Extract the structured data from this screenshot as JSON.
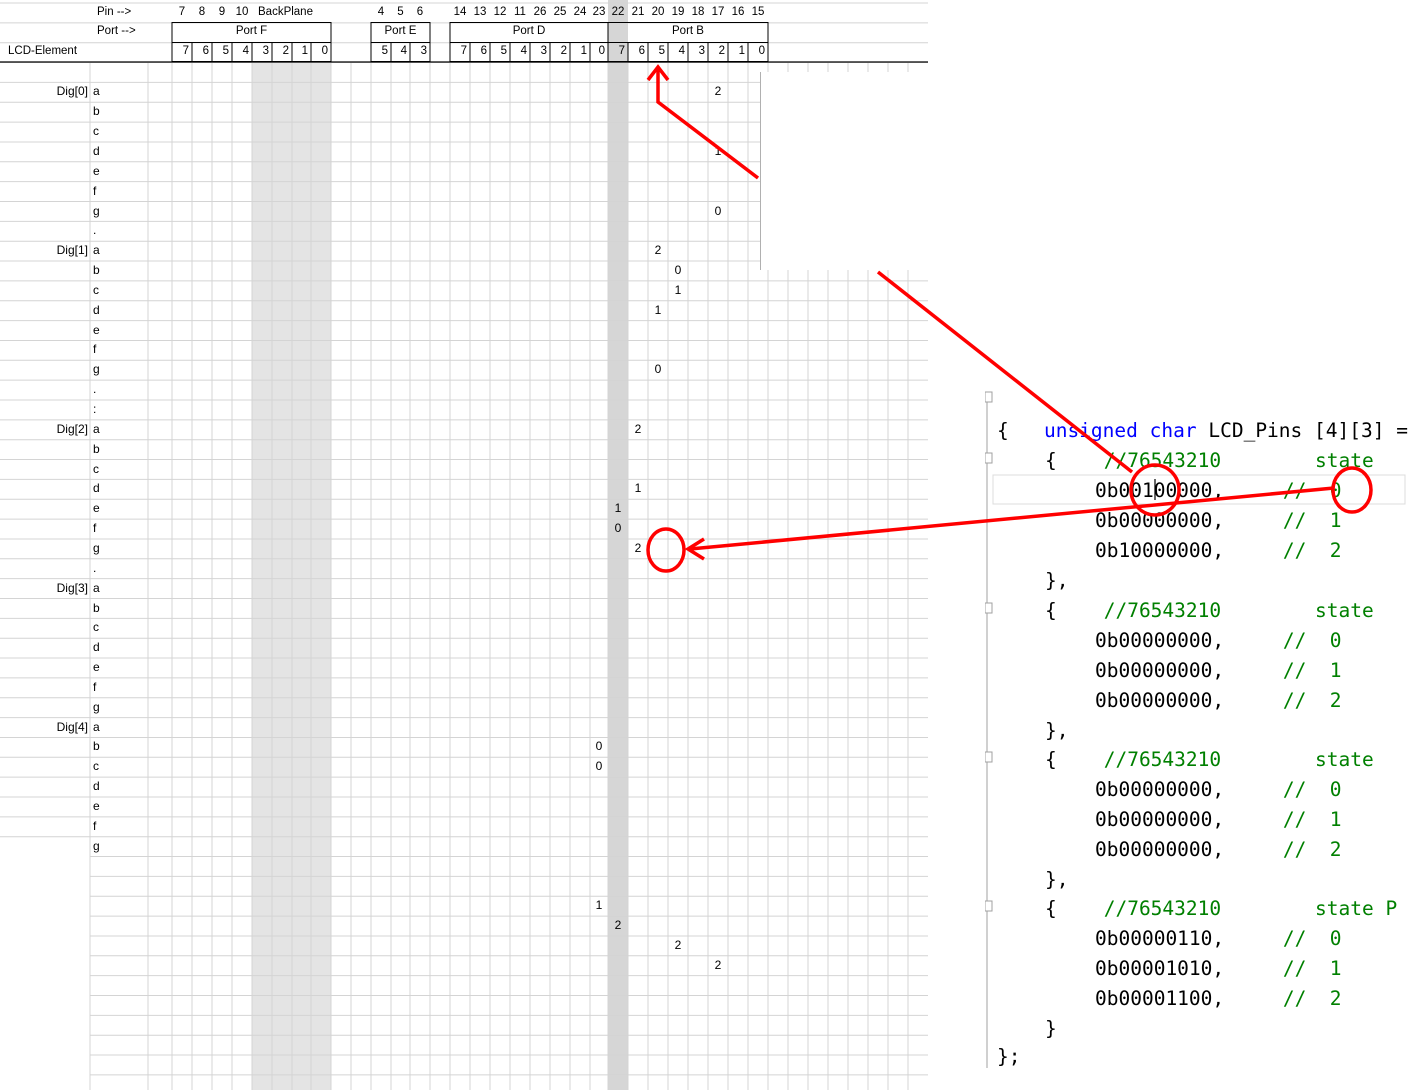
{
  "sheet": {
    "header_pin_label": "Pin -->",
    "header_port_label": "Port -->",
    "header_lcd_label": "LCD-Element",
    "pins": [
      "7",
      "8",
      "9",
      "10",
      "BackPlane",
      "4",
      "5",
      "6",
      "14",
      "13",
      "12",
      "11",
      "26",
      "25",
      "24",
      "23",
      "22",
      "21",
      "20",
      "19",
      "18",
      "17",
      "16",
      "15"
    ],
    "ports": [
      "Port F",
      "Port E",
      "Port D",
      "Port B"
    ],
    "bits": [
      "7",
      "6",
      "5",
      "4",
      "3",
      "2",
      "1",
      "0",
      "5",
      "4",
      "3",
      "7",
      "6",
      "5",
      "4",
      "3",
      "2",
      "1",
      "0",
      "7",
      "6",
      "5",
      "4",
      "3",
      "2",
      "1",
      "0"
    ],
    "digits": [
      "Dig[0]",
      "Dig[1]",
      "Dig[2]",
      "Dig[3]",
      "Dig[4]"
    ],
    "segments": [
      "a",
      "b",
      "c",
      "d",
      "e",
      "f",
      "g",
      ".",
      ":"
    ],
    "cells": [
      "2",
      "1",
      "0",
      "2",
      "0",
      "1",
      "1",
      "0",
      "2",
      "1",
      "1",
      "0",
      "0",
      "0",
      "1",
      "2",
      "2",
      "2",
      "2"
    ]
  },
  "code": {
    "line1_kw1": "unsigned",
    "line1_kw2": "char",
    "line1_rest": "LCD_Pins [4][3] =",
    "open_brace": "{",
    "block_open": "{",
    "block_close": "},",
    "final_block_close": "}",
    "end": "};",
    "comment_header": "//76543210",
    "state_label": "state",
    "state_label_last": "state P",
    "comment_prefix": "//",
    "states": [
      "0",
      "1",
      "2"
    ],
    "blocks": [
      [
        "0b00100000,",
        "0b00000000,",
        "0b10000000,"
      ],
      [
        "0b00000000,",
        "0b00000000,",
        "0b00000000,"
      ],
      [
        "0b00000000,",
        "0b00000000,",
        "0b00000000,"
      ],
      [
        "0b00000110,",
        "0b00001010,",
        "0b00001100,"
      ]
    ]
  },
  "colors": {
    "annotation": "#ff0000",
    "keyword": "#0000ff",
    "comment": "#008000",
    "grid": "#d4d4d4",
    "shade": "#e4e4e4"
  }
}
